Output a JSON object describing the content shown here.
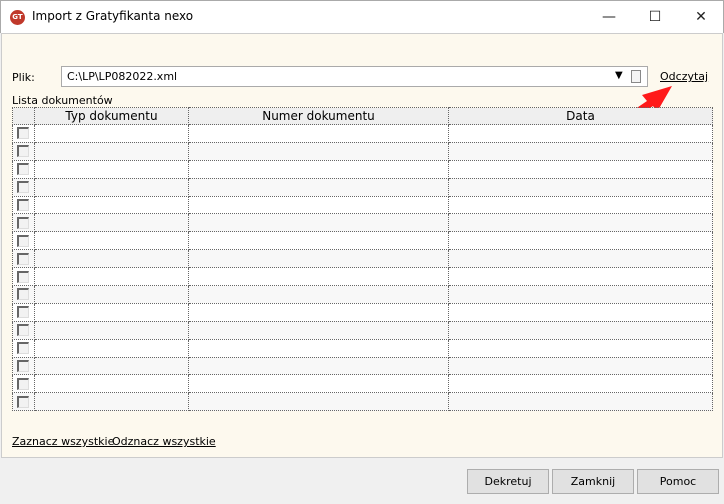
{
  "window": {
    "title": "Import z Gratyfikanta nexo",
    "icon_text": "GT",
    "minimize": "—",
    "maximize": "☐",
    "close": "✕"
  },
  "file": {
    "label": "Plik:",
    "value": "C:\\LP\\LP082022.xml",
    "read_link": "Odczytaj"
  },
  "list": {
    "label": "Lista dokumentów",
    "columns": [
      "Typ dokumentu",
      "Numer dokumentu",
      "Data"
    ],
    "row_count": 16
  },
  "links": {
    "select_all": "Zaznacz wszystkie",
    "deselect_all": "Odznacz wszystkie"
  },
  "buttons": {
    "post": "Dekretuj",
    "close": "Zamknij",
    "help": "Pomoc"
  },
  "colors": {
    "arrow": "#ff1a1a",
    "content_bg": "#fdf9ee"
  }
}
